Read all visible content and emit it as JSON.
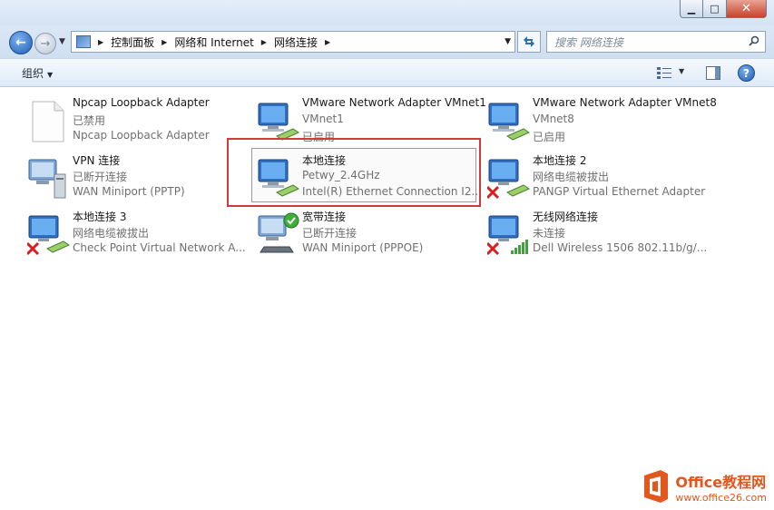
{
  "breadcrumb": [
    "控制面板",
    "网络和 Internet",
    "网络连接"
  ],
  "search": {
    "placeholder": "搜索 网络连接"
  },
  "toolbar": {
    "organize_label": "组织"
  },
  "connections": [
    {
      "name": "Npcap Loopback Adapter",
      "status": "已禁用",
      "device": "Npcap Loopback Adapter",
      "icon": "document-icon"
    },
    {
      "name": "VMware Network Adapter VMnet1",
      "status": "已启用",
      "device": "",
      "icon": "network-adapter-icon"
    },
    {
      "name": "VMware Network Adapter VMnet8",
      "status": "已启用",
      "device": "",
      "icon": "network-adapter-icon"
    },
    {
      "name": "VPN 连接",
      "status": "已断开连接",
      "device": "WAN Miniport (PPTP)",
      "icon": "vpn-icon"
    },
    {
      "name": "本地连接",
      "status": "Petwy_2.4GHz",
      "device": "Intel(R) Ethernet Connection I2...",
      "icon": "network-adapter-icon"
    },
    {
      "name": "本地连接 2",
      "status": "网络电缆被拔出",
      "device": "PANGP Virtual Ethernet Adapter",
      "icon": "network-disconnected-icon"
    },
    {
      "name": "本地连接 3",
      "status": "网络电缆被拔出",
      "device": "Check Point Virtual Network A...",
      "icon": "network-disconnected-icon"
    },
    {
      "name": "宽带连接",
      "status": "已断开连接",
      "device": "WAN Miniport (PPPOE)",
      "icon": "broadband-icon"
    },
    {
      "name": "无线网络连接",
      "status": "未连接",
      "device": "Dell Wireless 1506 802.11b/g/...",
      "icon": "wireless-disconnected-icon"
    }
  ],
  "watermark": {
    "title": "Office教程网",
    "url": "www.office26.com"
  },
  "colors": {
    "highlight": "#d13a3a",
    "accent": "#1d5db5"
  }
}
